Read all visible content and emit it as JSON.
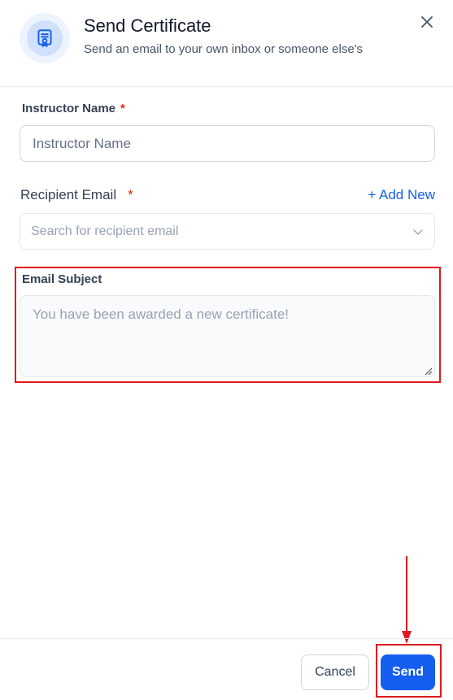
{
  "header": {
    "title": "Send Certificate",
    "subtitle": "Send an email to your own inbox or someone else's",
    "icon": "certificate-icon"
  },
  "form": {
    "instructor": {
      "label": "Instructor Name",
      "required_mark": "*",
      "placeholder": "Instructor Name",
      "value": ""
    },
    "recipient": {
      "label": "Recipient Email",
      "required_mark": "*",
      "add_new_label": "+ Add New",
      "placeholder": "Search for recipient email"
    },
    "subject": {
      "label": "Email Subject",
      "placeholder": "You have been awarded a new certificate!"
    }
  },
  "footer": {
    "cancel_label": "Cancel",
    "send_label": "Send"
  },
  "colors": {
    "accent": "#155eef",
    "required": "#d92d20",
    "annotation": "#e0191e"
  }
}
